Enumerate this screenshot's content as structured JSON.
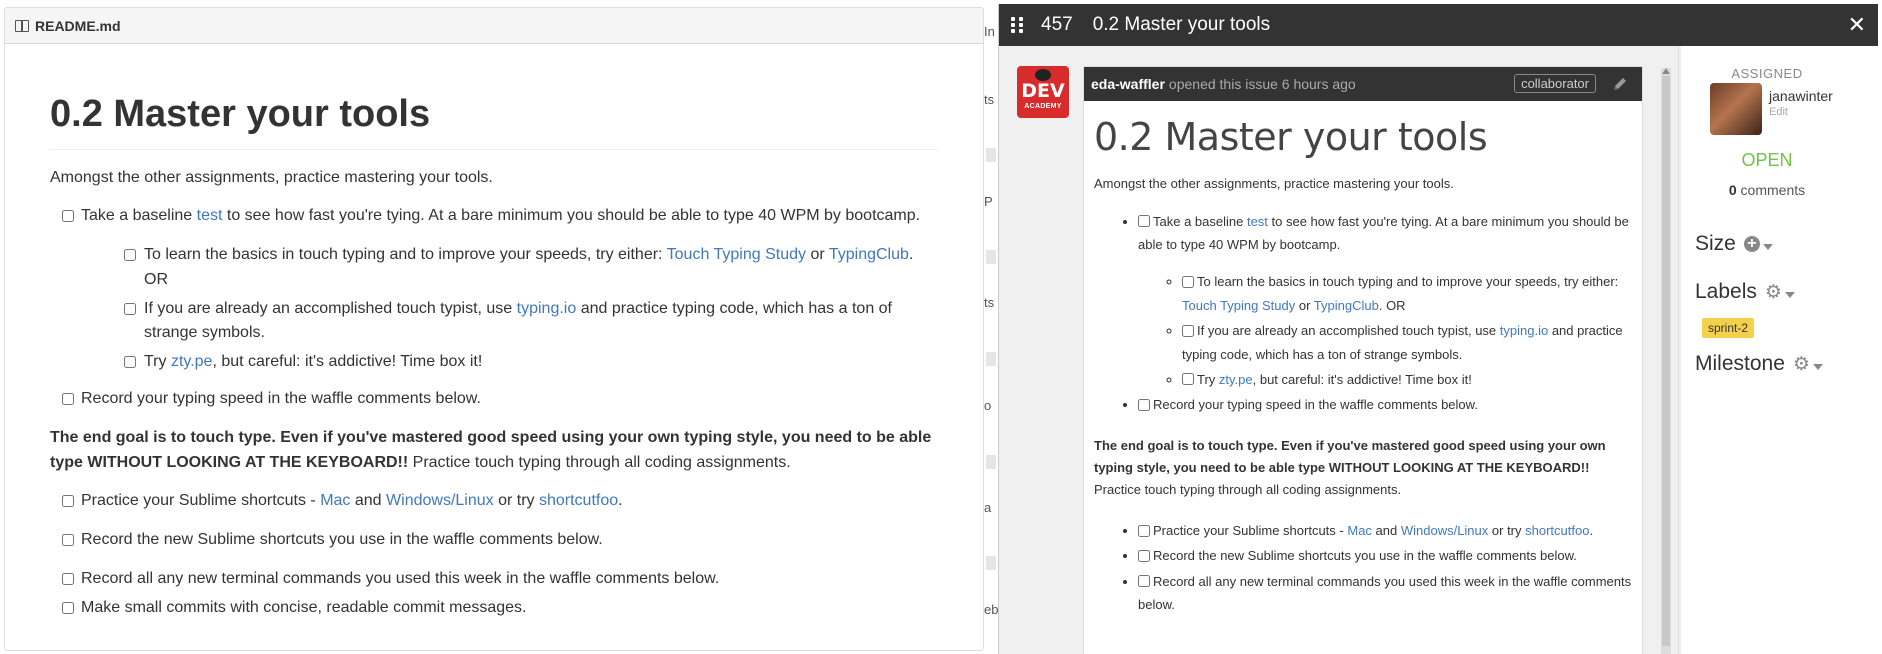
{
  "readme": {
    "filename": "README.md",
    "title": "0.2 Master your tools",
    "intro": "Amongst the other assignments, practice mastering your tools.",
    "item1_pre": "Take a baseline ",
    "item1_link": "test",
    "item1_post": " to see how fast you're tying. At a bare minimum you should be able to type 40 WPM by bootcamp.",
    "sub1_pre": "To learn the basics in touch typing and to improve your speeds, try either: ",
    "sub1_link1": "Touch Typing Study",
    "sub1_mid": " or ",
    "sub1_link2": "TypingClub",
    "sub1_post": ". OR",
    "sub2_pre": "If you are already an accomplished touch typist, use ",
    "sub2_link": "typing.io",
    "sub2_post": " and practice typing code, which has a ton of strange symbols.",
    "sub3_pre": "Try ",
    "sub3_link": "zty.pe",
    "sub3_post": ", but careful: it's addictive! Time box it!",
    "item2": "Record your typing speed in the waffle comments below.",
    "goal_bold": "The end goal is to touch type. Even if you've mastered good speed using your own typing style, you need to be able type WITHOUT LOOKING AT THE KEYBOARD!!",
    "goal_rest": " Practice touch typing through all coding assignments.",
    "item3_pre": "Practice your Sublime shortcuts - ",
    "item3_link1": "Mac",
    "item3_mid": " and ",
    "item3_link2": "Windows/Linux",
    "item3_mid2": " or try ",
    "item3_link3": "shortcutfoo",
    "item3_post": ".",
    "item4": "Record the new Sublime shortcuts you use in the waffle comments below.",
    "item5": "Record all any new terminal commands you used this week in the waffle comments below.",
    "item6": "Make small commits with concise, readable commit messages."
  },
  "background": {
    "frag_in": "In",
    "frag_ts": "ts",
    "frag_p": "P",
    "frag_ts2": "ts",
    "frag_o": "o",
    "frag_a": "a",
    "frag_eb": "eb"
  },
  "modal": {
    "issue_number": "457",
    "issue_title": "0.2 Master your tools",
    "close_glyph": "✕",
    "avatar_text": "DEV",
    "avatar_sub": "ACADEMY",
    "author": "eda-waffler",
    "opened_text": "opened this issue 6 hours ago",
    "role_badge": "collaborator",
    "body": {
      "title": "0.2 Master your tools",
      "intro": "Amongst the other assignments, practice mastering your tools.",
      "item1_pre": "Take a baseline ",
      "item1_link": "test",
      "item1_post": " to see how fast you're tying. At a bare minimum you should be able to type 40 WPM by bootcamp.",
      "sub1_pre": "To learn the basics in touch typing and to improve your speeds, try either: ",
      "sub1_link1": "Touch Typing Study",
      "sub1_mid": " or ",
      "sub1_link2": "TypingClub",
      "sub1_post": ". OR",
      "sub2_pre": "If you are already an accomplished touch typist, use ",
      "sub2_link": "typing.io",
      "sub2_post": " and practice typing code, which has a ton of strange symbols.",
      "sub3_pre": "Try ",
      "sub3_link": "zty.pe",
      "sub3_post": ", but careful: it's addictive! Time box it!",
      "item2": "Record your typing speed in the waffle comments below.",
      "goal_bold": "The end goal is to touch type. Even if you've mastered good speed using your own typing style, you need to be able type WITHOUT LOOKING AT THE KEYBOARD!!",
      "goal_rest": "Practice touch typing through all coding assignments.",
      "item3_pre": "Practice your Sublime shortcuts - ",
      "item3_link1": "Mac",
      "item3_mid": " and ",
      "item3_link2": "Windows/Linux",
      "item3_mid2": " or try ",
      "item3_link3": "shortcutfoo",
      "item3_post": ".",
      "item4": "Record the new Sublime shortcuts you use in the waffle comments below.",
      "item5": "Record all any new terminal commands you used this week in the waffle comments below."
    }
  },
  "sidebar": {
    "assigned_label": "ASSIGNED",
    "assignee": "janawinter",
    "edit_label": "Edit",
    "status": "OPEN",
    "comment_count": "0",
    "comments_label": " comments",
    "size_label": "Size",
    "labels_label": "Labels",
    "label_chip": "sprint-2",
    "milestone_label": "Milestone"
  },
  "colors": {
    "link": "#4078c0",
    "status_open": "#6cc644",
    "label_chip": "#f5d04a",
    "modal_header": "#333333",
    "avatar_bg": "#d82c2c"
  },
  "icons": [
    "book-icon",
    "drag-grip-icon",
    "close-icon",
    "pencil-icon",
    "plus-circle-icon",
    "gear-icon",
    "caret-down-icon"
  ]
}
